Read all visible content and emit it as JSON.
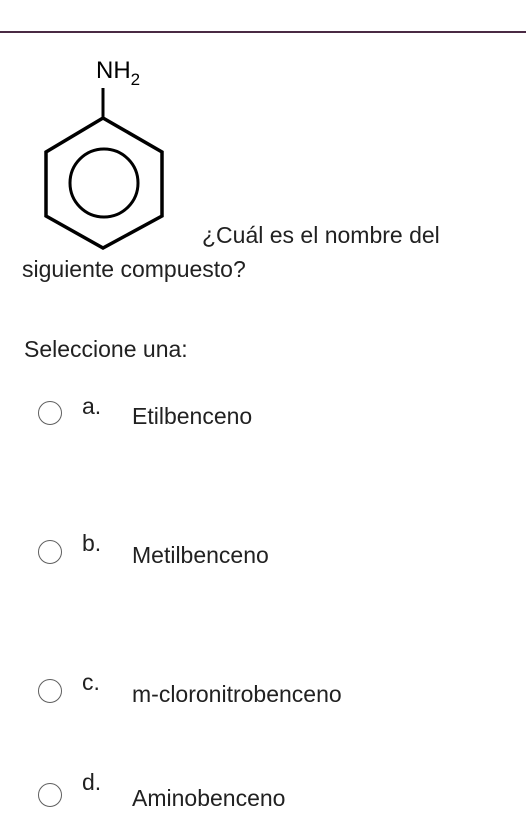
{
  "question": {
    "line1": "¿Cuál es el nombre del",
    "line2": "siguiente compuesto?"
  },
  "structure": {
    "substituent_main": "NH",
    "substituent_sub": "2"
  },
  "prompt": "Seleccione una:",
  "options": [
    {
      "letter": "a.",
      "text": "Etilbenceno"
    },
    {
      "letter": "b.",
      "text": "Metilbenceno"
    },
    {
      "letter": "c.",
      "text": "m-cloronitrobenceno"
    },
    {
      "letter": "d.",
      "text": "Aminobenceno"
    }
  ]
}
